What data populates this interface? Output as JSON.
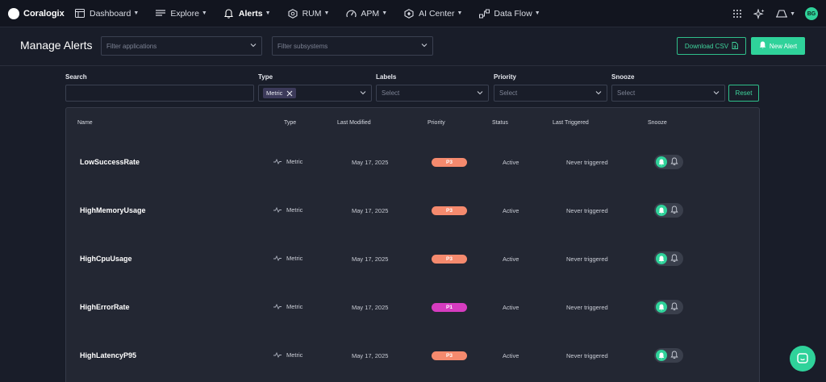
{
  "app": {
    "brand": "Coralogix",
    "avatar_initials": "BG",
    "accent": "#2fd29a"
  },
  "nav": {
    "items": [
      {
        "label": "Dashboard",
        "icon": "dashboard-icon"
      },
      {
        "label": "Explore",
        "icon": "explore-icon"
      },
      {
        "label": "Alerts",
        "icon": "bell-icon"
      },
      {
        "label": "RUM",
        "icon": "rum-icon"
      },
      {
        "label": "APM",
        "icon": "apm-gauge-icon"
      },
      {
        "label": "AI Center",
        "icon": "ai-center-icon"
      },
      {
        "label": "Data Flow",
        "icon": "data-flow-icon"
      }
    ],
    "right_icons": [
      "apps-grid-icon",
      "sparkle-icon",
      "environment-icon"
    ]
  },
  "header": {
    "title": "Manage Alerts",
    "filter_applications_placeholder": "Filter applications",
    "filter_subsystems_placeholder": "Filter subsystems",
    "download_label": "Download CSV",
    "new_alert_label": "New Alert"
  },
  "filters": {
    "search_label": "Search",
    "search_value": "",
    "type_label": "Type",
    "type_chip": "Metric",
    "labels_label": "Labels",
    "labels_placeholder": "Select",
    "priority_label": "Priority",
    "priority_placeholder": "Select",
    "snooze_label": "Snooze",
    "snooze_placeholder": "Select",
    "reset_label": "Reset"
  },
  "table": {
    "headers": [
      "Name",
      "Type",
      "Last Modified",
      "Priority",
      "Status",
      "Last Triggered",
      "Snooze"
    ],
    "rows": [
      {
        "name": "LowSuccessRate",
        "type": "Metric",
        "modified": "May 17, 2025",
        "priority": "P3",
        "status": "Active",
        "triggered": "Never triggered"
      },
      {
        "name": "HighMemoryUsage",
        "type": "Metric",
        "modified": "May 17, 2025",
        "priority": "P3",
        "status": "Active",
        "triggered": "Never triggered"
      },
      {
        "name": "HighCpuUsage",
        "type": "Metric",
        "modified": "May 17, 2025",
        "priority": "P3",
        "status": "Active",
        "triggered": "Never triggered"
      },
      {
        "name": "HighErrorRate",
        "type": "Metric",
        "modified": "May 17, 2025",
        "priority": "P1",
        "status": "Active",
        "triggered": "Never triggered"
      },
      {
        "name": "HighLatencyP95",
        "type": "Metric",
        "modified": "May 17, 2025",
        "priority": "P3",
        "status": "Active",
        "triggered": "Never triggered"
      }
    ]
  },
  "priority_colors": {
    "P1": "#d63cc0",
    "P3": "#f58a6e"
  }
}
